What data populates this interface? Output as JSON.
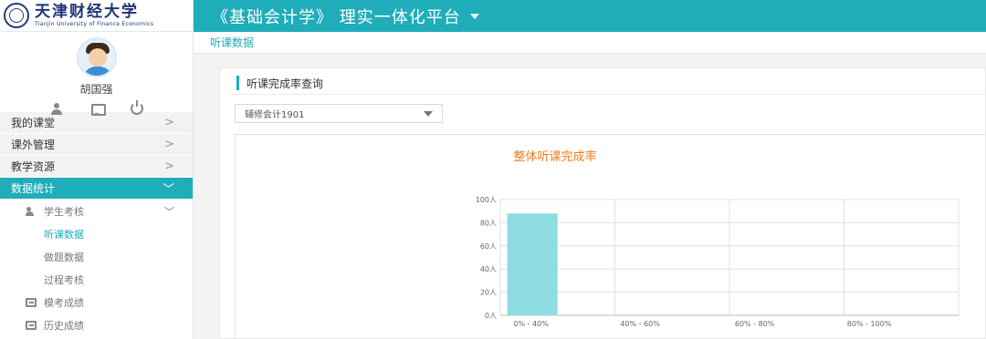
{
  "logo": {
    "cn": "天津财经大学",
    "en": "Tianjin University of Finance Economics"
  },
  "user": {
    "name": "胡国强"
  },
  "menu": [
    {
      "label": "我的课堂",
      "chev": ">"
    },
    {
      "label": "课外管理",
      "chev": ">"
    },
    {
      "label": "教学资源",
      "chev": ">"
    },
    {
      "label": "数据统计",
      "chev": "﹀",
      "active": true
    }
  ],
  "submenu": {
    "student_exam": {
      "label": "学生考核",
      "chev": "﹀"
    },
    "items": [
      "听课数据",
      "做题数据",
      "过程考核"
    ],
    "mock_scores": "模考成绩",
    "history_scores": "历史成绩"
  },
  "topbar": {
    "title": "《基础会计学》 理实一体化平台"
  },
  "breadcrumb": {
    "current": "听课数据"
  },
  "panel": {
    "title": "听课完成率查询"
  },
  "class_select": {
    "value": "辅修会计1901"
  },
  "chart_data": {
    "type": "bar",
    "title": "整体听课完成率",
    "categories": [
      "0% - 40%",
      "40% - 60%",
      "60% - 80%",
      "80% - 100%"
    ],
    "values": [
      88,
      0,
      0,
      0
    ],
    "ylim": [
      0,
      100
    ],
    "y_ticks": [
      "0人",
      "20人",
      "40人",
      "60人",
      "80人",
      "100人"
    ],
    "bar_color": "#8fdde3",
    "grid": true
  },
  "colors": {
    "accent": "#1fadb9",
    "chart_title": "#f07d23"
  }
}
